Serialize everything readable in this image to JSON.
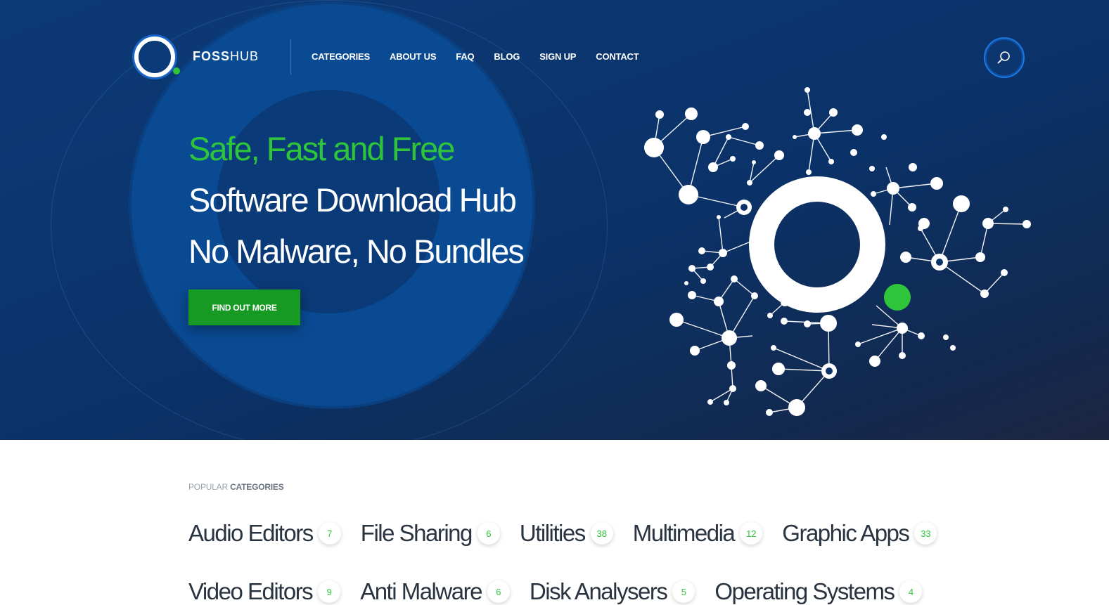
{
  "header": {
    "brand_bold": "FOSS",
    "brand_thin": "HUB",
    "nav": [
      "CATEGORIES",
      "ABOUT US",
      "FAQ",
      "BLOG",
      "SIGN UP",
      "CONTACT"
    ]
  },
  "hero": {
    "line1": "Safe, Fast and Free",
    "line2": "Software Download Hub",
    "line3": "No Malware, No Bundles",
    "cta_label": "FIND OUT MORE"
  },
  "categories": {
    "label_light": "POPULAR",
    "label_bold": "CATEGORIES",
    "row1": [
      {
        "name": "Audio Editors",
        "count": "7"
      },
      {
        "name": "File Sharing",
        "count": "6"
      },
      {
        "name": "Utilities",
        "count": "38"
      },
      {
        "name": "Multimedia",
        "count": "12"
      },
      {
        "name": "Graphic Apps",
        "count": "33"
      }
    ],
    "row2": [
      {
        "name": "Video Editors",
        "count": "9"
      },
      {
        "name": "Anti Malware",
        "count": "6"
      },
      {
        "name": "Disk Analysers",
        "count": "5"
      },
      {
        "name": "Operating Systems",
        "count": "4"
      }
    ]
  },
  "colors": {
    "hero_bg": "#0b3268",
    "accent_green": "#2fc53b",
    "button_green": "#169a24",
    "accent_blue": "#1a78e0"
  },
  "icons": {
    "logo": "fosshub-ring-logo",
    "search": "search-icon",
    "network": "network-graph-illustration"
  }
}
